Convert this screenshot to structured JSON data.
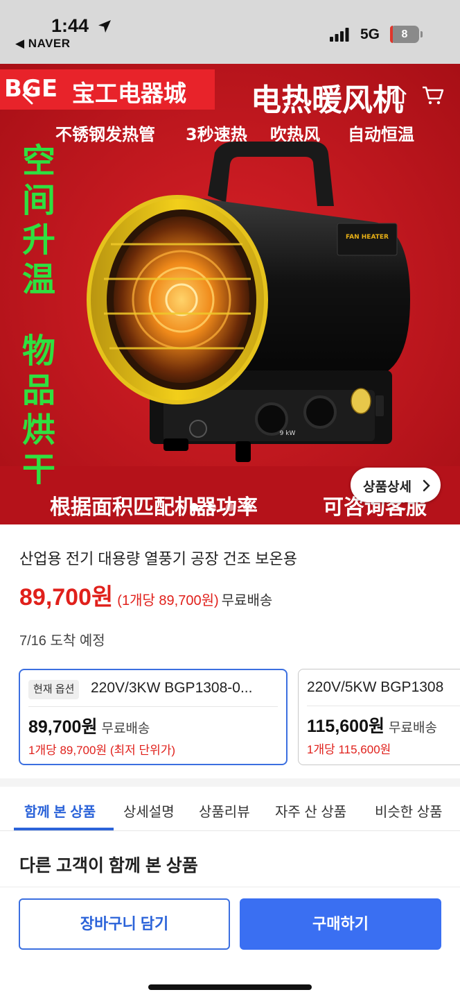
{
  "status_bar": {
    "time": "1:44",
    "back_app": "◀ NAVER",
    "network": "5G",
    "battery": "8",
    "battery_level": 0.08,
    "icons": [
      "location-arrow-icon",
      "signal-bars-icon"
    ]
  },
  "hero": {
    "brand_logo": "BGE",
    "brand_name": "宝工电器城",
    "title": "电热暖风机",
    "features": [
      "不锈钢发热管",
      "3秒速热",
      "吹热风",
      "自动恒温"
    ],
    "side_text_top": "空间升温",
    "side_text_bottom": "物品烘干",
    "bottom_text_left": "根据面积匹配机器功率",
    "bottom_text_right": "可咨询客服",
    "heater_label": "FAN HEATER",
    "heater_power": "9 kW",
    "detail_button": "상품상세",
    "carousel_total": 4,
    "carousel_active": 1,
    "colors": {
      "background": "#c8161d",
      "side_text": "#2fe040",
      "heater_ring": "#f2cf1a"
    },
    "icons": [
      "back-chevron-icon",
      "home-icon",
      "cart-icon",
      "chevron-right-icon"
    ]
  },
  "product": {
    "title": "산업용 전기 대용량 열풍기 공장 건조 보온용",
    "price": "89,700원",
    "unit_price": "(1개당 89,700원)",
    "shipping": "무료배송",
    "arrival": "7/16 도착 예정"
  },
  "options": [
    {
      "badge": "현재 옵션",
      "name": "220V/3KW BGP1308-0...",
      "price": "89,700원",
      "shipping": "무료배송",
      "unit": "1개당 89,700원 (최저 단위가)",
      "selected": true
    },
    {
      "name": "220V/5KW BGP1308",
      "price": "115,600원",
      "shipping": "무료배송",
      "unit": "1개당 115,600원",
      "selected": false
    }
  ],
  "tabs": [
    "함께 본 상품",
    "상세설명",
    "상품리뷰",
    "자주 산 상품",
    "비슷한 상품"
  ],
  "active_tab": "함께 본 상품",
  "section_title": "다른 고객이 함께 본 상품",
  "actions": {
    "cart": "장바구니 담기",
    "buy": "구매하기"
  },
  "colors": {
    "accent": "#3a6ff2",
    "price": "#e0201b"
  }
}
